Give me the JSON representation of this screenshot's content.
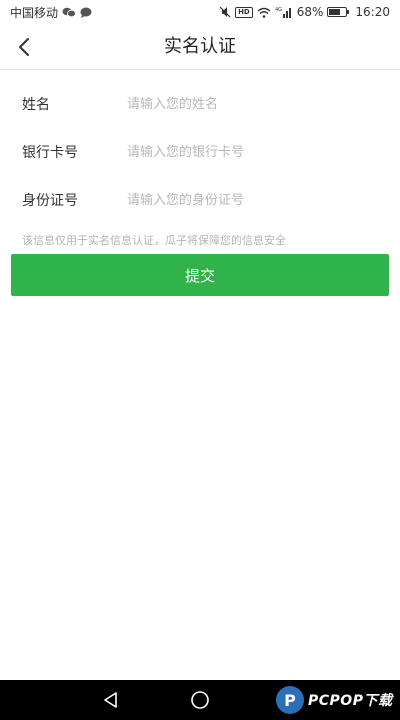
{
  "status_bar": {
    "carrier": "中国移动",
    "network": "4G",
    "battery_percent": "68%",
    "battery_level": 0.68,
    "time": "16:20",
    "icons": [
      "wechat-icon",
      "message-icon",
      "mute-icon",
      "hd-icon",
      "wifi-icon",
      "signal-icon",
      "battery-icon"
    ]
  },
  "header": {
    "title": "实名认证",
    "back_icon": "chevron-left-icon"
  },
  "form": {
    "name": {
      "label": "姓名",
      "placeholder": "请输入您的姓名"
    },
    "bank_card": {
      "label": "银行卡号",
      "placeholder": "请输入您的银行卡号"
    },
    "id_number": {
      "label": "身份证号",
      "placeholder": "请输入您的身份证号"
    },
    "note": "该信息仅用于实名信息认证，瓜子将保障您的信息安全",
    "submit_label": "提交"
  },
  "colors": {
    "accent": "#2fb34a",
    "placeholder": "#b8b8b8"
  },
  "system_nav": {
    "icons": [
      "nav-back-icon",
      "nav-home-icon"
    ]
  },
  "watermark": {
    "text": "PCPOP下载",
    "logo_letter": "P"
  }
}
